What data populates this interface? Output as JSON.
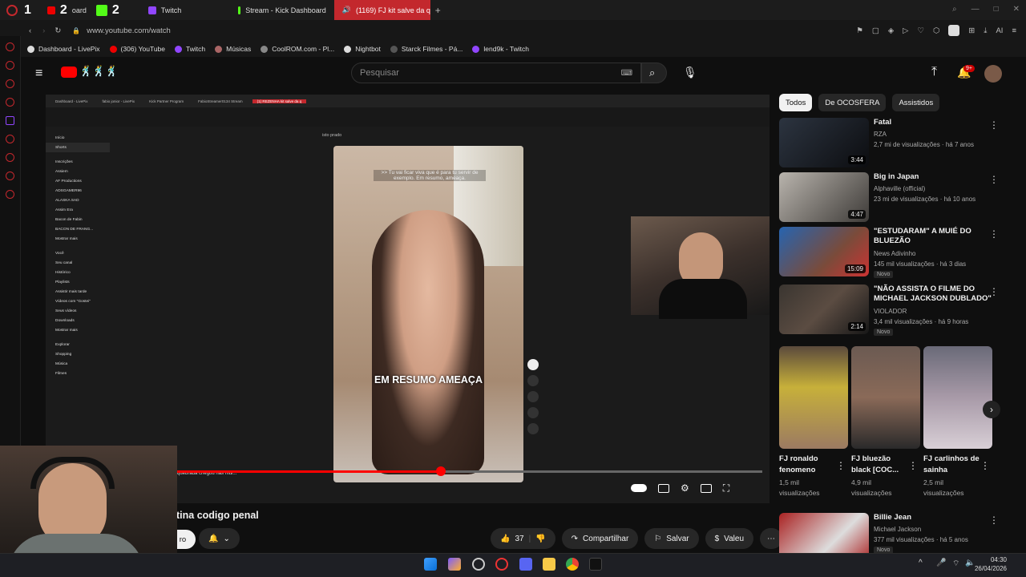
{
  "browser": {
    "tabs": [
      {
        "label": "1",
        "kind": "number"
      },
      {
        "label": "2",
        "kind": "number"
      },
      {
        "label": "oard",
        "kind": "text"
      },
      {
        "label": "2",
        "kind": "number"
      },
      {
        "label": "Twitch",
        "kind": "text"
      },
      {
        "label": "Stream - Kick Dashboard",
        "kind": "text"
      },
      {
        "label": "(1169) FJ kit salve da q",
        "kind": "text"
      }
    ],
    "new_tab": "+",
    "url": "www.youtube.com/watch",
    "bookmarks": [
      "Dashboard - LivePix",
      "(306) YouTube",
      "Twitch",
      "Músicas",
      "CoolROM.com - Pl...",
      "Nightbot",
      "Starck Filmes - Pá...",
      "lend9k - Twitch"
    ],
    "toolbar_right": "AI"
  },
  "youtube": {
    "search_placeholder": "Pesquisar",
    "notif_count": "9+",
    "chips": [
      "Todos",
      "De OCOSFERA",
      "Assistidos"
    ],
    "video": {
      "caption": "EM RESUMO AMEAÇA",
      "subtitle": ">> Tu vai ficar viva que é para tu servir de exemplo. Em resumo, ameaça.",
      "inner_search": "isto prado",
      "inner_sidebar": [
        "Início",
        "Shorts",
        "Inscrições",
        "Assiem",
        "AF Productions",
        "ADSGAMER96",
        "ALASKA SAD",
        "Assim Era",
        "Bacon de Fabin",
        "BACON DE FRANG...",
        "Mostrar mais",
        "Você",
        "Seu canal",
        "Histórico",
        "Playlists",
        "Assistir mais tarde",
        "Vídeos com \"Gostei\"",
        "Seus vídeos",
        "Downloads",
        "Mostrar mais",
        "Explorar",
        "Shopping",
        "Música",
        "Filmes"
      ],
      "inner_tabs": [
        "Dashboard - LivePix",
        "fabio jonior - LivePix",
        "Kick Partner Program",
        "FabioStreamer0134 Stream",
        "(1) REZENHA kit salve da q"
      ],
      "overlay_text": "quebrada chegou nas mul...",
      "progress": 0.45
    },
    "title": "tina codigo penal",
    "actions": {
      "subscribe_fragment": "ro",
      "likes": "37",
      "share": "Compartilhar",
      "save": "Salvar",
      "thanks": "Valeu"
    },
    "recommendations": [
      {
        "title": "Fatal",
        "channel": "RZA",
        "meta": "2,7 mi de visualizações · há 7 anos",
        "duration": "3:44",
        "badge": ""
      },
      {
        "title": "Big in Japan",
        "channel": "Alphaville (official)",
        "meta": "23 mi de visualizações · há 10 anos",
        "duration": "4:47",
        "badge": ""
      },
      {
        "title": "\"ESTUDARAM\" A MUIÉ DO BLUEZÃO",
        "channel": "News Adivinho",
        "meta": "145 mil visualizações · há 3 dias",
        "duration": "15:09",
        "badge": "Novo"
      },
      {
        "title": "\"NÃO ASSISTA O FILME DO MICHAEL JACKSON DUBLADO\"",
        "channel": "VIOLADOR",
        "meta": "3,4 mil visualizações · há 9 horas",
        "duration": "2:14",
        "badge": "Novo"
      }
    ],
    "shorts": [
      {
        "title": "FJ ronaldo fenomeno",
        "meta1": "1,5 mil",
        "meta2": "visualizações"
      },
      {
        "title": "FJ bluezão black [COC...",
        "meta1": "4,9 mil",
        "meta2": "visualizações"
      },
      {
        "title": "FJ carlinhos de sainha",
        "meta1": "2,5 mil",
        "meta2": "visualizações"
      }
    ],
    "last_rec": {
      "title": "Billie Jean",
      "channel": "Michael Jackson",
      "meta": "377 mil visualizações · há 5 anos",
      "badge": "Novo"
    }
  },
  "taskbar": {
    "time": "04:30",
    "date": "26/04/2026"
  },
  "colors": {
    "accent": "#c3282d",
    "yt_red": "#ff0000"
  }
}
